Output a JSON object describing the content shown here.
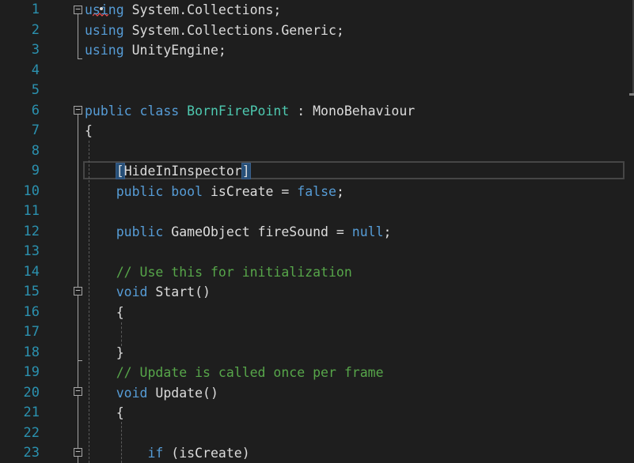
{
  "editor": {
    "lines": [
      {
        "n": "1",
        "tokens": [
          {
            "t": "using",
            "c": "kw"
          },
          {
            "t": " System.Collections;"
          }
        ]
      },
      {
        "n": "2",
        "tokens": [
          {
            "t": "using",
            "c": "kw"
          },
          {
            "t": " System.Collections.Generic;"
          }
        ]
      },
      {
        "n": "3",
        "tokens": [
          {
            "t": "using",
            "c": "kw"
          },
          {
            "t": " UnityEngine;"
          }
        ]
      },
      {
        "n": "4",
        "tokens": []
      },
      {
        "n": "5",
        "tokens": []
      },
      {
        "n": "6",
        "tokens": [
          {
            "t": "public",
            "c": "kw"
          },
          {
            "t": " "
          },
          {
            "t": "class",
            "c": "kw"
          },
          {
            "t": " "
          },
          {
            "t": "BornFirePoint",
            "c": "ty"
          },
          {
            "t": " : MonoBehaviour"
          }
        ]
      },
      {
        "n": "7",
        "tokens": [
          {
            "t": "{"
          }
        ]
      },
      {
        "n": "8",
        "tokens": []
      },
      {
        "n": "9",
        "tokens": [
          {
            "t": "    "
          },
          {
            "t": "[",
            "c": "hl"
          },
          {
            "t": "HideInInspector"
          },
          {
            "t": "]",
            "c": "hl"
          }
        ]
      },
      {
        "n": "10",
        "tokens": [
          {
            "t": "    "
          },
          {
            "t": "public",
            "c": "kw"
          },
          {
            "t": " "
          },
          {
            "t": "bool",
            "c": "kw"
          },
          {
            "t": " isCreate = "
          },
          {
            "t": "false",
            "c": "kw"
          },
          {
            "t": ";"
          }
        ]
      },
      {
        "n": "11",
        "tokens": []
      },
      {
        "n": "12",
        "tokens": [
          {
            "t": "    "
          },
          {
            "t": "public",
            "c": "kw"
          },
          {
            "t": " GameObject fireSound = "
          },
          {
            "t": "null",
            "c": "kw"
          },
          {
            "t": ";"
          }
        ]
      },
      {
        "n": "13",
        "tokens": []
      },
      {
        "n": "14",
        "tokens": [
          {
            "t": "    "
          },
          {
            "t": "// Use this for initialization",
            "c": "cm"
          }
        ]
      },
      {
        "n": "15",
        "tokens": [
          {
            "t": "    "
          },
          {
            "t": "void",
            "c": "kw"
          },
          {
            "t": " Start()"
          }
        ]
      },
      {
        "n": "16",
        "tokens": [
          {
            "t": "    {"
          }
        ]
      },
      {
        "n": "17",
        "tokens": []
      },
      {
        "n": "18",
        "tokens": [
          {
            "t": "    }"
          }
        ]
      },
      {
        "n": "19",
        "tokens": [
          {
            "t": "    "
          },
          {
            "t": "// Update is called once per frame",
            "c": "cm"
          }
        ]
      },
      {
        "n": "20",
        "tokens": [
          {
            "t": "    "
          },
          {
            "t": "void",
            "c": "kw"
          },
          {
            "t": " Update()"
          }
        ]
      },
      {
        "n": "21",
        "tokens": [
          {
            "t": "    {"
          }
        ]
      },
      {
        "n": "22",
        "tokens": []
      },
      {
        "n": "23",
        "tokens": [
          {
            "t": "        "
          },
          {
            "t": "if",
            "c": "kw"
          },
          {
            "t": " (isCreate)"
          }
        ]
      }
    ]
  },
  "fold_markers": {
    "collapse_symbol": "−"
  },
  "colors": {
    "background": "#1e1e1e",
    "line_number": "#2b91af",
    "keyword": "#569cd6",
    "type": "#4ec9b0",
    "comment": "#57a64a",
    "text": "#dcdcdc"
  },
  "icons": {
    "fold": "collapse-box-icon",
    "quick_action": "quick-action-dot-icon",
    "error": "error-squiggle-icon"
  }
}
